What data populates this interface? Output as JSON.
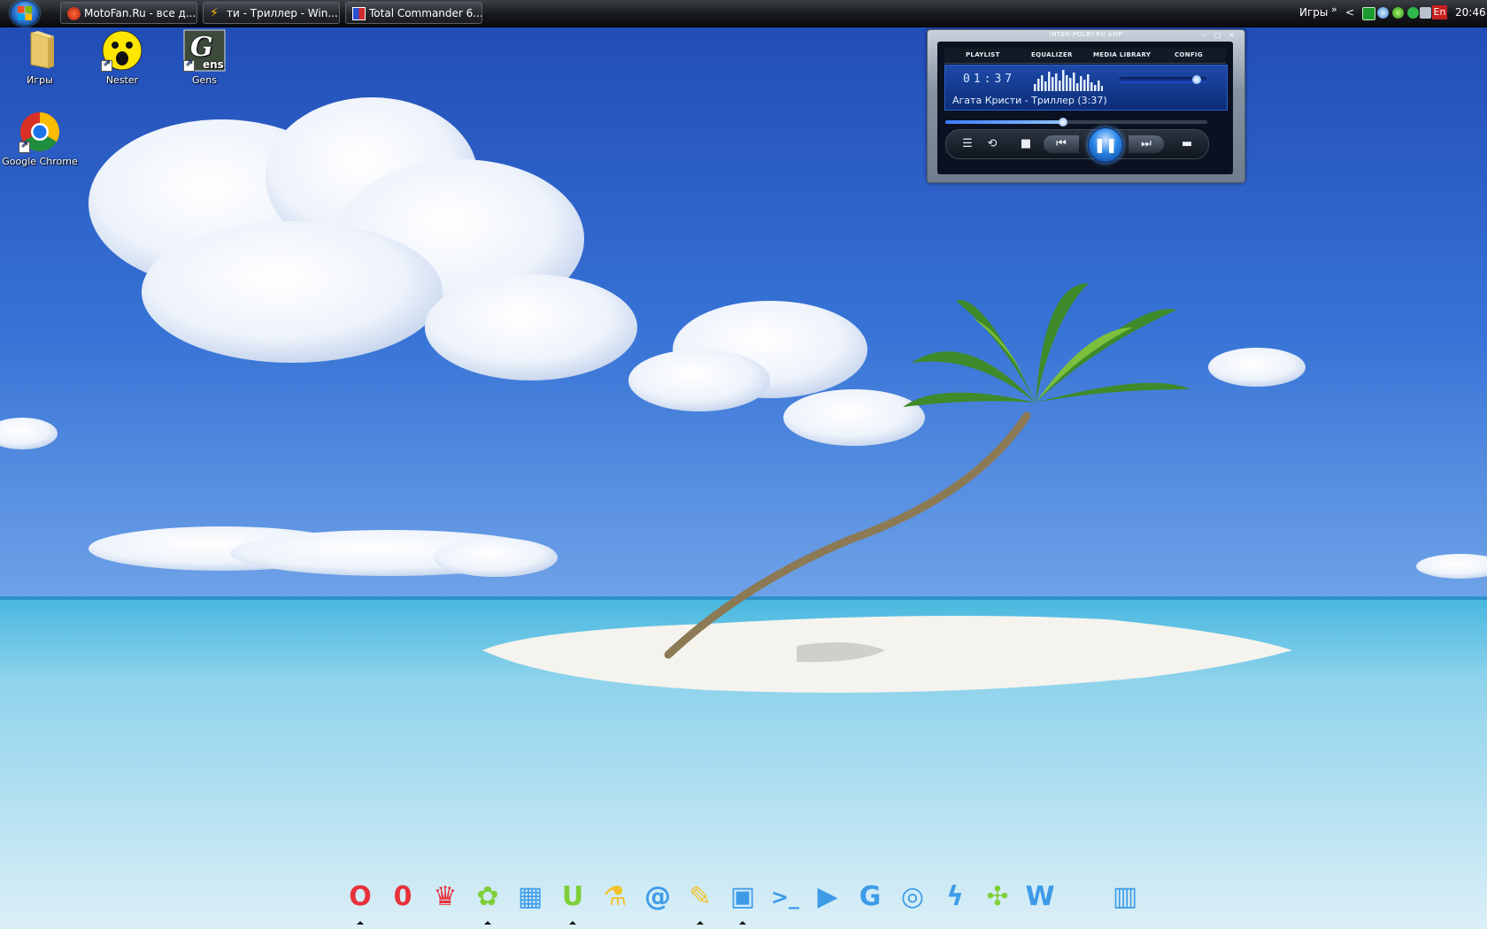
{
  "taskbar": {
    "tasks": [
      {
        "label": "MotoFan.Ru - все д..."
      },
      {
        "label": "ти - Триллер - Win..."
      },
      {
        "label": "Total Commander 6..."
      }
    ],
    "tray": {
      "toolbar_label": "Игры",
      "expand_glyph": "»",
      "collapse_glyph": "<",
      "language": "En",
      "clock": "20:46"
    }
  },
  "desktop_icons": [
    {
      "label": "Игры",
      "icon": "folder-icon"
    },
    {
      "label": "Nester",
      "icon": "nester-icon"
    },
    {
      "label": "Gens",
      "icon": "gens-icon"
    },
    {
      "label": "Google Chrome",
      "icon": "chrome-icon"
    }
  ],
  "player": {
    "window_title": "INTER-POLBY.RU AMP",
    "tabs": [
      "PLAYLIST",
      "EQUALIZER",
      "MEDIA LIBRARY",
      "CONFIG"
    ],
    "time": "01:37",
    "track": "Агата Кристи - Триллер (3:37)",
    "progress": 0.45,
    "volume": 0.88
  },
  "dock": {
    "icons": [
      "opera-icon",
      "opera-mini-icon",
      "crown-icon",
      "icq-icon",
      "media-grid-icon",
      "utorrent-icon",
      "flask-icon",
      "mail-icon",
      "feather-icon",
      "floppy-icon",
      "terminal-icon",
      "play-icon",
      "google-icon",
      "burn-disc-icon",
      "lightning-icon",
      "puzzle-icon",
      "word-icon",
      "apple-icon",
      "trash-icon"
    ],
    "colors": {
      "red": "#e8323b",
      "green": "#7fcf3a",
      "blue": "#3d9be8",
      "yellow": "#f2c22c"
    }
  }
}
